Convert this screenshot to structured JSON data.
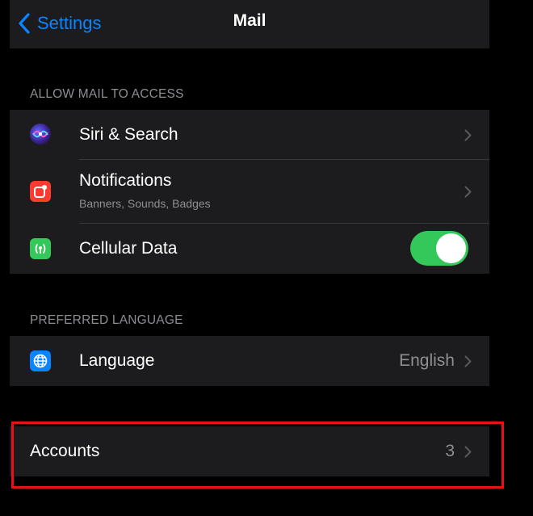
{
  "colors": {
    "background": "#000000",
    "cell": "#1c1c1e",
    "accent": "#0a84ff",
    "toggle_on": "#34c759",
    "secondary_text": "#8e8e93",
    "highlight": "#e8101a"
  },
  "navbar": {
    "back_label": "Settings",
    "back_icon": "chevron-left-icon",
    "title": "Mail"
  },
  "sections": {
    "access": {
      "header": "ALLOW MAIL TO ACCESS",
      "siri": {
        "label": "Siri & Search",
        "icon": "siri-icon"
      },
      "notifications": {
        "label": "Notifications",
        "sublabel": "Banners, Sounds, Badges",
        "icon": "notifications-icon"
      },
      "cellular": {
        "label": "Cellular Data",
        "icon": "cellular-data-icon",
        "enabled": true
      }
    },
    "language": {
      "header": "PREFERRED LANGUAGE",
      "row": {
        "label": "Language",
        "value": "English",
        "icon": "globe-icon"
      }
    },
    "accounts": {
      "row": {
        "label": "Accounts",
        "value": "3"
      }
    }
  }
}
